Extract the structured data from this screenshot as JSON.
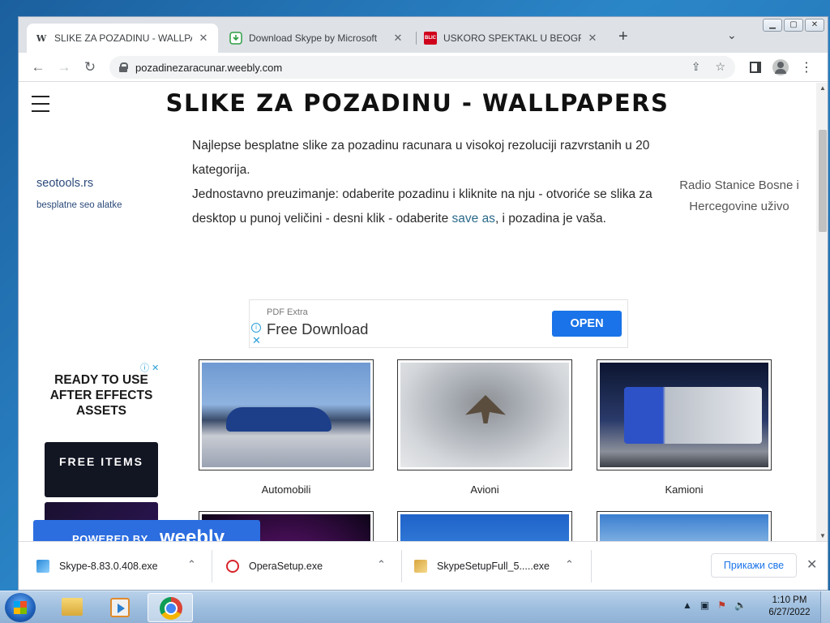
{
  "browser": {
    "tabs": [
      {
        "title": "SLIKE ZA POZADINU - WALLPAPERS",
        "favicon": "W",
        "active": true
      },
      {
        "title": "Download Skype by Microsoft",
        "favicon": "download-icon",
        "active": false
      },
      {
        "title": "USKORO SPEKTAKL U BEOGRADU",
        "favicon": "BLIC",
        "active": false
      }
    ],
    "new_tab": "+",
    "url": "pozadinezaracunar.weebly.com"
  },
  "page": {
    "site_title": "SLIKE ZA POZADINU - WALLPAPERS",
    "intro_line1": "Najlepse besplatne slike za pozadinu racunara u visokoj rezoluciji razvrstanih u 20 kategorija.",
    "intro_line2_before": "Jednostavno preuzimanje: odaberite pozadinu i kliknite na nju - otvoriće se slika za desktop u punoj veličini - desni klik - odaberite ",
    "intro_link": "save as",
    "intro_line2_after": ", i pozadina je vaša.",
    "left_link": "seotools.rs",
    "left_sub": "besplatne seo alatke",
    "right_link": "Radio Stanice Bosne i Hercegovine uživo"
  },
  "ad_banner": {
    "small": "PDF Extra",
    "big": "Free Download",
    "button": "OPEN"
  },
  "side_ad": {
    "headline": "READY TO USE AFTER EFFECTS ASSETS",
    "tile": "FREE ITEMS"
  },
  "gallery": [
    {
      "label": "Automobili"
    },
    {
      "label": "Avioni"
    },
    {
      "label": "Kamioni"
    },
    {
      "label": ""
    },
    {
      "label": ""
    },
    {
      "label": ""
    }
  ],
  "weebly": {
    "powered": "POWERED BY",
    "brand": "weebly"
  },
  "downloads": {
    "items": [
      {
        "name": "Skype-8.83.0.408.exe"
      },
      {
        "name": "OperaSetup.exe"
      },
      {
        "name": "SkypeSetupFull_5.....exe"
      }
    ],
    "show_all": "Прикажи све"
  },
  "taskbar": {
    "time": "1:10 PM",
    "date": "6/27/2022"
  }
}
